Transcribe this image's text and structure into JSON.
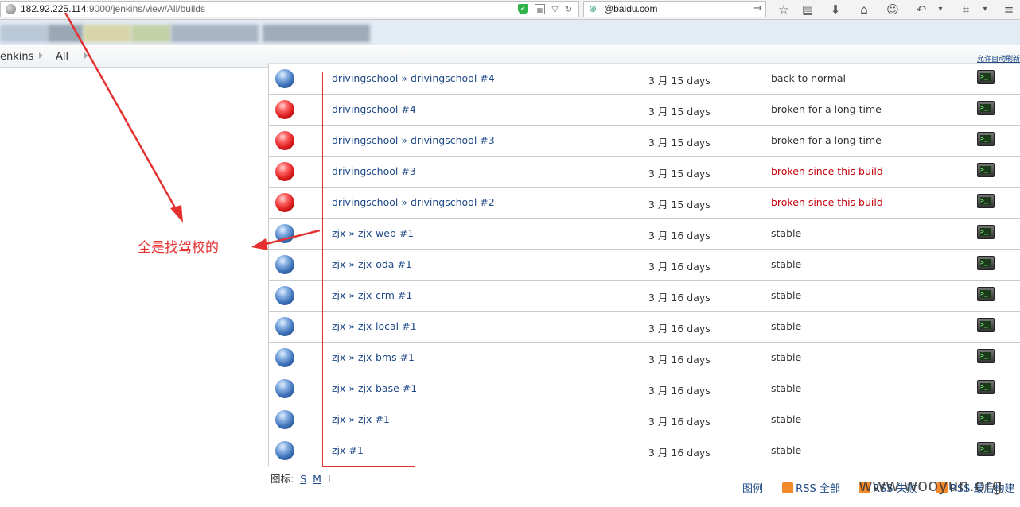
{
  "browser": {
    "url_host": "182.92.225.114",
    "url_rest": ":9000/jenkins/view/All/builds",
    "search_text": "@baidu.com"
  },
  "breadcrumb": {
    "root": "enkins",
    "view": "All",
    "auto_refresh": "允许自动刷新"
  },
  "builds": [
    {
      "status_color": "blue",
      "job": "drivingschool » drivingschool",
      "build": "#4",
      "time": "3 月 15 days",
      "status": "back to normal",
      "bad": false
    },
    {
      "status_color": "red",
      "job": "drivingschool",
      "build": "#4",
      "time": "3 月 15 days",
      "status": "broken for a long time",
      "bad": false
    },
    {
      "status_color": "red",
      "job": "drivingschool » drivingschool",
      "build": "#3",
      "time": "3 月 15 days",
      "status": "broken for a long time",
      "bad": false
    },
    {
      "status_color": "red",
      "job": "drivingschool",
      "build": "#3",
      "time": "3 月 15 days",
      "status": "broken since this build",
      "bad": true
    },
    {
      "status_color": "red",
      "job": "drivingschool » drivingschool",
      "build": "#2",
      "time": "3 月 15 days",
      "status": "broken since this build",
      "bad": true
    },
    {
      "status_color": "blue",
      "job": "zjx » zjx-web",
      "build": "#1",
      "time": "3 月 16 days",
      "status": "stable",
      "bad": false
    },
    {
      "status_color": "blue",
      "job": "zjx » zjx-oda",
      "build": "#1",
      "time": "3 月 16 days",
      "status": "stable",
      "bad": false
    },
    {
      "status_color": "blue",
      "job": "zjx » zjx-crm",
      "build": "#1",
      "time": "3 月 16 days",
      "status": "stable",
      "bad": false
    },
    {
      "status_color": "blue",
      "job": "zjx » zjx-local",
      "build": "#1",
      "time": "3 月 16 days",
      "status": "stable",
      "bad": false
    },
    {
      "status_color": "blue",
      "job": "zjx » zjx-bms",
      "build": "#1",
      "time": "3 月 16 days",
      "status": "stable",
      "bad": false
    },
    {
      "status_color": "blue",
      "job": "zjx » zjx-base",
      "build": "#1",
      "time": "3 月 16 days",
      "status": "stable",
      "bad": false
    },
    {
      "status_color": "blue",
      "job": "zjx » zjx",
      "build": "#1",
      "time": "3 月 16 days",
      "status": "stable",
      "bad": false
    },
    {
      "status_color": "blue",
      "job": "zjx",
      "build": "#1",
      "time": "3 月 16 days",
      "status": "stable",
      "bad": false
    }
  ],
  "footer": {
    "icon_label": "图标:",
    "size_s": "S",
    "size_m": "M",
    "size_l": "L",
    "legend": "图例",
    "rss_all": "RSS 全部",
    "rss_failed": "RSS 失败",
    "rss_latest": "RSS 最后构建"
  },
  "annotation": {
    "text": "全是找驾校的"
  },
  "watermark": "www.wooyun.org",
  "colors": {
    "link": "#204a87",
    "broken_text": "#c4000a",
    "annotation": "#e53030"
  }
}
